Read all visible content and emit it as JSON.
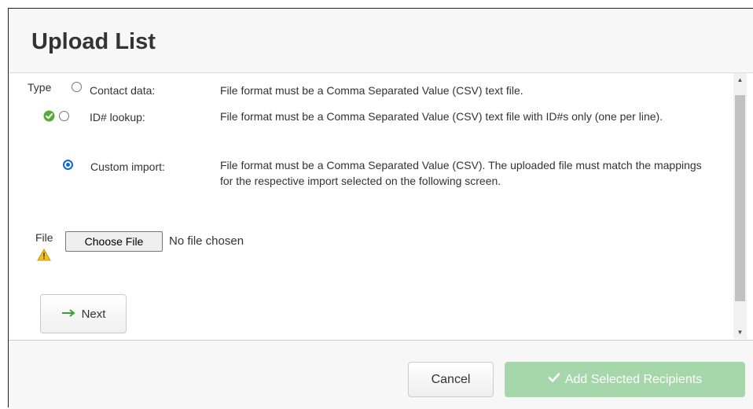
{
  "dialog": {
    "title": "Upload List"
  },
  "type_section": {
    "label": "Type",
    "options": [
      {
        "label": "Contact data:",
        "description": "File format must be a Comma Separated Value (CSV) text file.",
        "selected": false
      },
      {
        "label": "ID# lookup:",
        "description": "File format must be a Comma Separated Value (CSV) text file with ID#s only (one per line).",
        "selected": false
      },
      {
        "label": "Custom import:",
        "description": "File format must be a Comma Separated Value (CSV). The uploaded file must match the mappings for the respective import selected on the following screen.",
        "selected": true
      }
    ]
  },
  "file_section": {
    "label": "File",
    "choose_button": "Choose File",
    "status": "No file chosen"
  },
  "buttons": {
    "next": "Next",
    "cancel": "Cancel",
    "add_selected": "Add Selected Recipients"
  },
  "colors": {
    "radio_selected": "#0a69d6",
    "success_icon": "#5aaa3a",
    "warning_icon": "#f0c020",
    "next_arrow": "#3aa03a",
    "add_button_bg": "#a6d7ab"
  },
  "icons": {
    "validation_ok": "check-circle-icon",
    "file_warning": "warning-triangle-icon",
    "next_arrow": "arrow-right-icon",
    "add_check": "checkmark-icon"
  }
}
